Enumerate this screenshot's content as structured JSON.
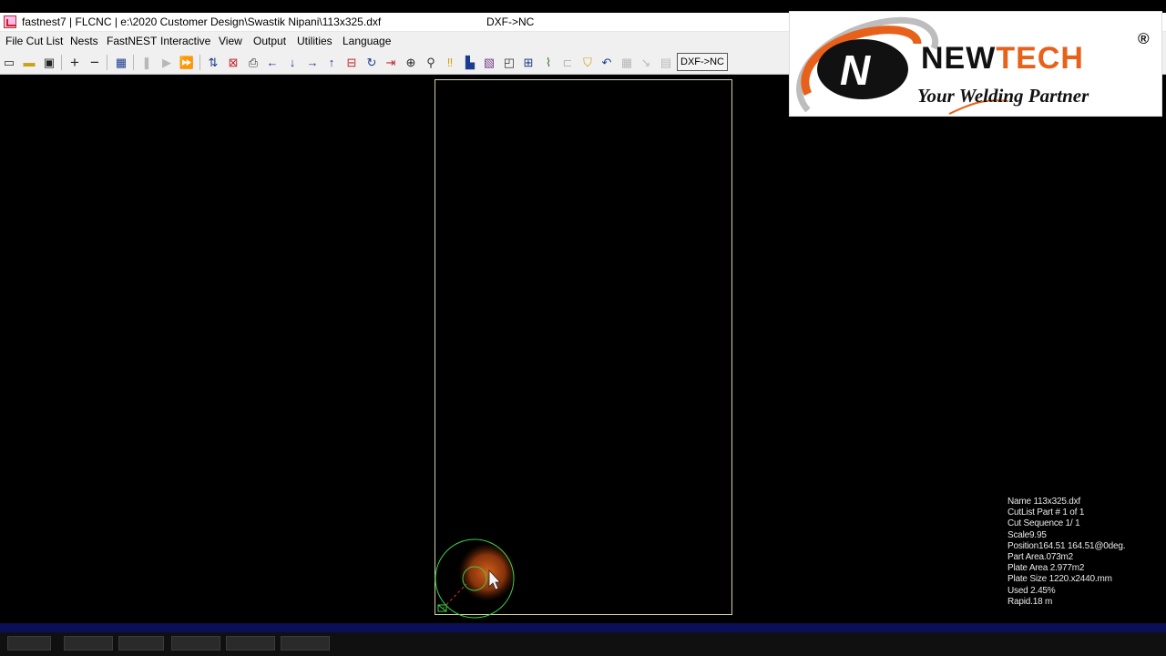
{
  "window": {
    "title_left": "fastnest7  |  FLCNC  |  e:\\2020 Customer Design\\Swastik Nipani\\113x325.dxf",
    "title_right": "DXF->NC"
  },
  "menu": [
    "File Cut List",
    "Nests",
    "FastNEST",
    "Interactive",
    "View",
    "Output",
    "Utilities",
    "Language"
  ],
  "toolbar": {
    "icons": [
      "new-file-icon",
      "open-folder-icon",
      "save-icon",
      "add-icon",
      "remove-icon",
      "grid-icon",
      "pause-icon",
      "play-icon",
      "fast-forward-icon",
      "sort-up-icon",
      "cancel-icon",
      "print-icon",
      "arrow-left-icon",
      "arrow-down-icon",
      "arrow-right-icon",
      "arrow-up-icon",
      "print-part-icon",
      "refresh-icon",
      "move-right-icon",
      "add-part-icon",
      "zoom-icon",
      "warning-icon",
      "stack-icon",
      "rectangle-icon",
      "zoom-window-icon",
      "fit-icon",
      "path-icon",
      "disabled-icon",
      "lock-icon",
      "undo-icon",
      "grid-disabled-icon",
      "pointer-disabled-icon",
      "table-disabled-icon"
    ],
    "dxf_nc_label": "DXF->NC"
  },
  "status": {
    "name": "Name 113x325.dxf",
    "cutlist_part": "CutList Part  # 1 of  1",
    "cut_sequence": "Cut Sequence 1/ 1",
    "scale": "Scale9.95",
    "position": "Position164.51 164.51@0deg.",
    "part_area": "Part Area.073m2",
    "plate_area": "Plate Area 2.977m2",
    "plate_size": "Plate Size  1220.x2440.mm",
    "used": "Used  2.45%",
    "rapid": "Rapid.18 m"
  },
  "logo": {
    "brand_a": "NEW",
    "brand_b": "TECH",
    "registered": "®",
    "tagline": "Your Welding Partner"
  },
  "colors": {
    "plate_border": "#d6d2a0",
    "part_outline": "#3bd14a",
    "highlight": "#c04a10",
    "brand_orange": "#e8611b",
    "taskbar": "#0b0f58"
  }
}
